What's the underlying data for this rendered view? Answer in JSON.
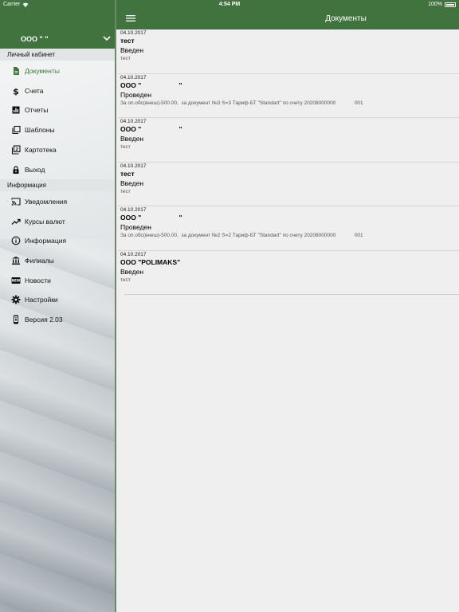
{
  "status_bar": {
    "carrier": "Carrier",
    "time": "4:54 PM",
    "battery": "100%"
  },
  "sidebar": {
    "account_name": "ООО \"             \"",
    "sections": [
      {
        "label": "Личный кабинет",
        "items": [
          {
            "label": "Документы",
            "icon": "document-icon",
            "active": true
          },
          {
            "label": "Счета",
            "icon": "dollar-icon"
          },
          {
            "label": "Отчеты",
            "icon": "bar-chart-icon"
          },
          {
            "label": "Шаблоны",
            "icon": "templates-icon"
          },
          {
            "label": "Картотека",
            "icon": "card-index-icon"
          },
          {
            "label": "Выход",
            "icon": "lock-icon"
          }
        ]
      },
      {
        "label": "Информация",
        "items": [
          {
            "label": "Уведомления",
            "icon": "cast-icon"
          },
          {
            "label": "Курсы валют",
            "icon": "trending-up-icon"
          },
          {
            "label": "Информация",
            "icon": "info-icon"
          },
          {
            "label": "Филиалы",
            "icon": "bank-icon"
          },
          {
            "label": "Новости",
            "icon": "news-icon"
          },
          {
            "label": "Настройки",
            "icon": "gear-icon"
          },
          {
            "label": "Версия 2.03",
            "icon": "phone-icon"
          }
        ]
      }
    ],
    "accent_color": "#40733e"
  },
  "header": {
    "title": "Документы"
  },
  "documents": [
    {
      "date": "04.10.2017",
      "title": "тест",
      "state": "Введен",
      "desc": "тест"
    },
    {
      "date": "04.10.2017",
      "title": "ООО \"                    \"",
      "state": "Проведен",
      "desc": "За оп.обс(внеш)-500.00,  за документ №3 S=3 Тариф-БТ \"Standart\" по счету 20208000000             001"
    },
    {
      "date": "04.10.2017",
      "title": "ООО \"                    \"",
      "state": "Введен",
      "desc": "тест"
    },
    {
      "date": "04.10.2017",
      "title": "тест",
      "state": "Введен",
      "desc": "тест"
    },
    {
      "date": "04.10.2017",
      "title": "ООО \"                    \"",
      "state": "Проведен",
      "desc": "За оп.обс(внеш)-500.00,  за документ №2 S=2 Тариф-БТ \"Standart\" по счету 20208000000             001"
    },
    {
      "date": "04.10.2017",
      "title": "ООО \"POLIMAKS\"",
      "state": "Введен",
      "desc": "тест"
    }
  ]
}
